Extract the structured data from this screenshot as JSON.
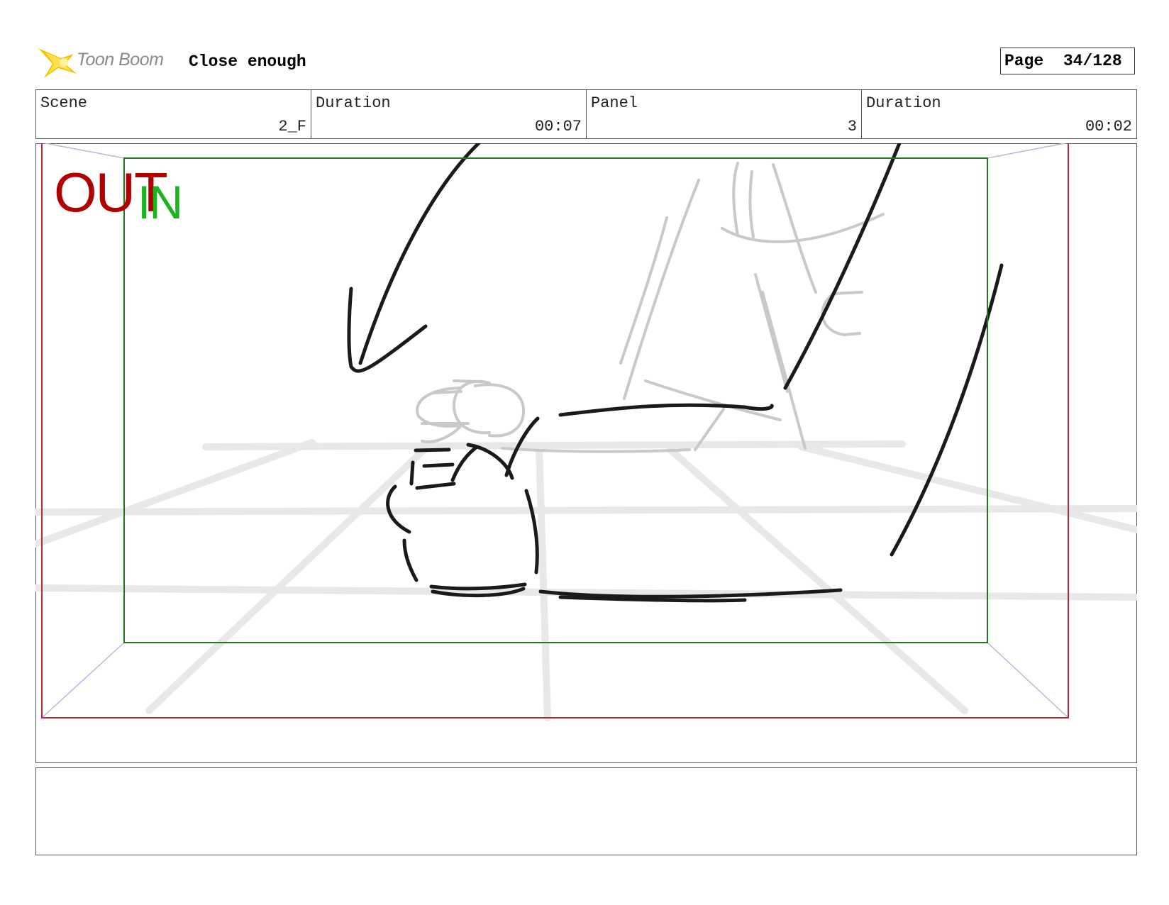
{
  "header": {
    "brand": "Toon Boom",
    "title": "Close enough",
    "page_label": "Page",
    "page_number": "34/128"
  },
  "info": {
    "scene_label": "Scene",
    "scene_value": "2_F",
    "scene_duration_label": "Duration",
    "scene_duration_value": "00:07",
    "panel_label": "Panel",
    "panel_value": "3",
    "panel_duration_label": "Duration",
    "panel_duration_value": "00:02"
  },
  "frame_markers": {
    "out": "OUT",
    "in": "IN",
    "out_color": "#b00000",
    "in_color": "#1db31d",
    "camera_path_color": "#b9b4e8"
  },
  "notes": {
    "text": ""
  }
}
